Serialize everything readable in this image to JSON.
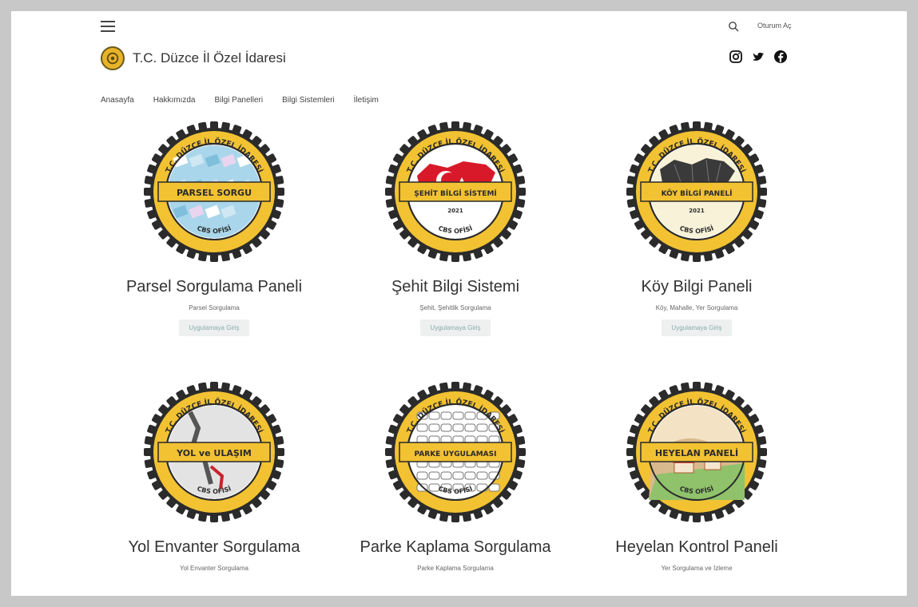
{
  "header": {
    "menu_icon": "hamburger-icon",
    "search_icon": "search-icon",
    "login_label": "Oturum Aç",
    "brand_title": "T.C. Düzce İl Özel İdaresi",
    "socials": [
      "instagram-icon",
      "twitter-icon",
      "facebook-icon"
    ]
  },
  "nav": {
    "items": [
      "Anasayfa",
      "Hakkımızda",
      "Bilgi Panelleri",
      "Bilgi Sistemleri",
      "İletişim"
    ]
  },
  "badge_common": {
    "ring_top_text": "T.C. DÜZCE İL ÖZEL İDARESİ",
    "ring_bottom_text": "CBS OFİSİ",
    "year": "2021",
    "gold": "#f2c232",
    "dark": "#2b2b2b"
  },
  "cards": [
    {
      "title": "Parsel Sorgulama Paneli",
      "subtitle": "Parsel Sorgulama",
      "button": "Uygulamaya Giriş",
      "badge_label": "PARSEL SORGU",
      "theme": "map"
    },
    {
      "title": "Şehit Bilgi Sistemi",
      "subtitle": "Şehit, Şehitlik Sorgulama",
      "button": "Uygulamaya Giriş",
      "badge_label": "ŞEHİT BİLGİ SİSTEMİ",
      "theme": "turkey"
    },
    {
      "title": "Köy Bilgi Paneli",
      "subtitle": "Köy, Mahalle, Yer Sorgulama",
      "button": "Uygulamaya Giriş",
      "badge_label": "KÖY BİLGİ PANELİ",
      "theme": "district"
    },
    {
      "title": "Yol Envanter Sorgulama",
      "subtitle": "Yol Envanter Sorgulama",
      "badge_label": "YOL ve ULAŞIM",
      "theme": "road"
    },
    {
      "title": "Parke Kaplama Sorgulama",
      "subtitle": "Parke Kaplama Sorgulama",
      "badge_label": "PARKE UYGULAMASI",
      "theme": "paving"
    },
    {
      "title": "Heyelan Kontrol Paneli",
      "subtitle": "Yer Sorgulama ve İzleme",
      "badge_label": "HEYELAN PANELİ",
      "theme": "landslide"
    }
  ]
}
